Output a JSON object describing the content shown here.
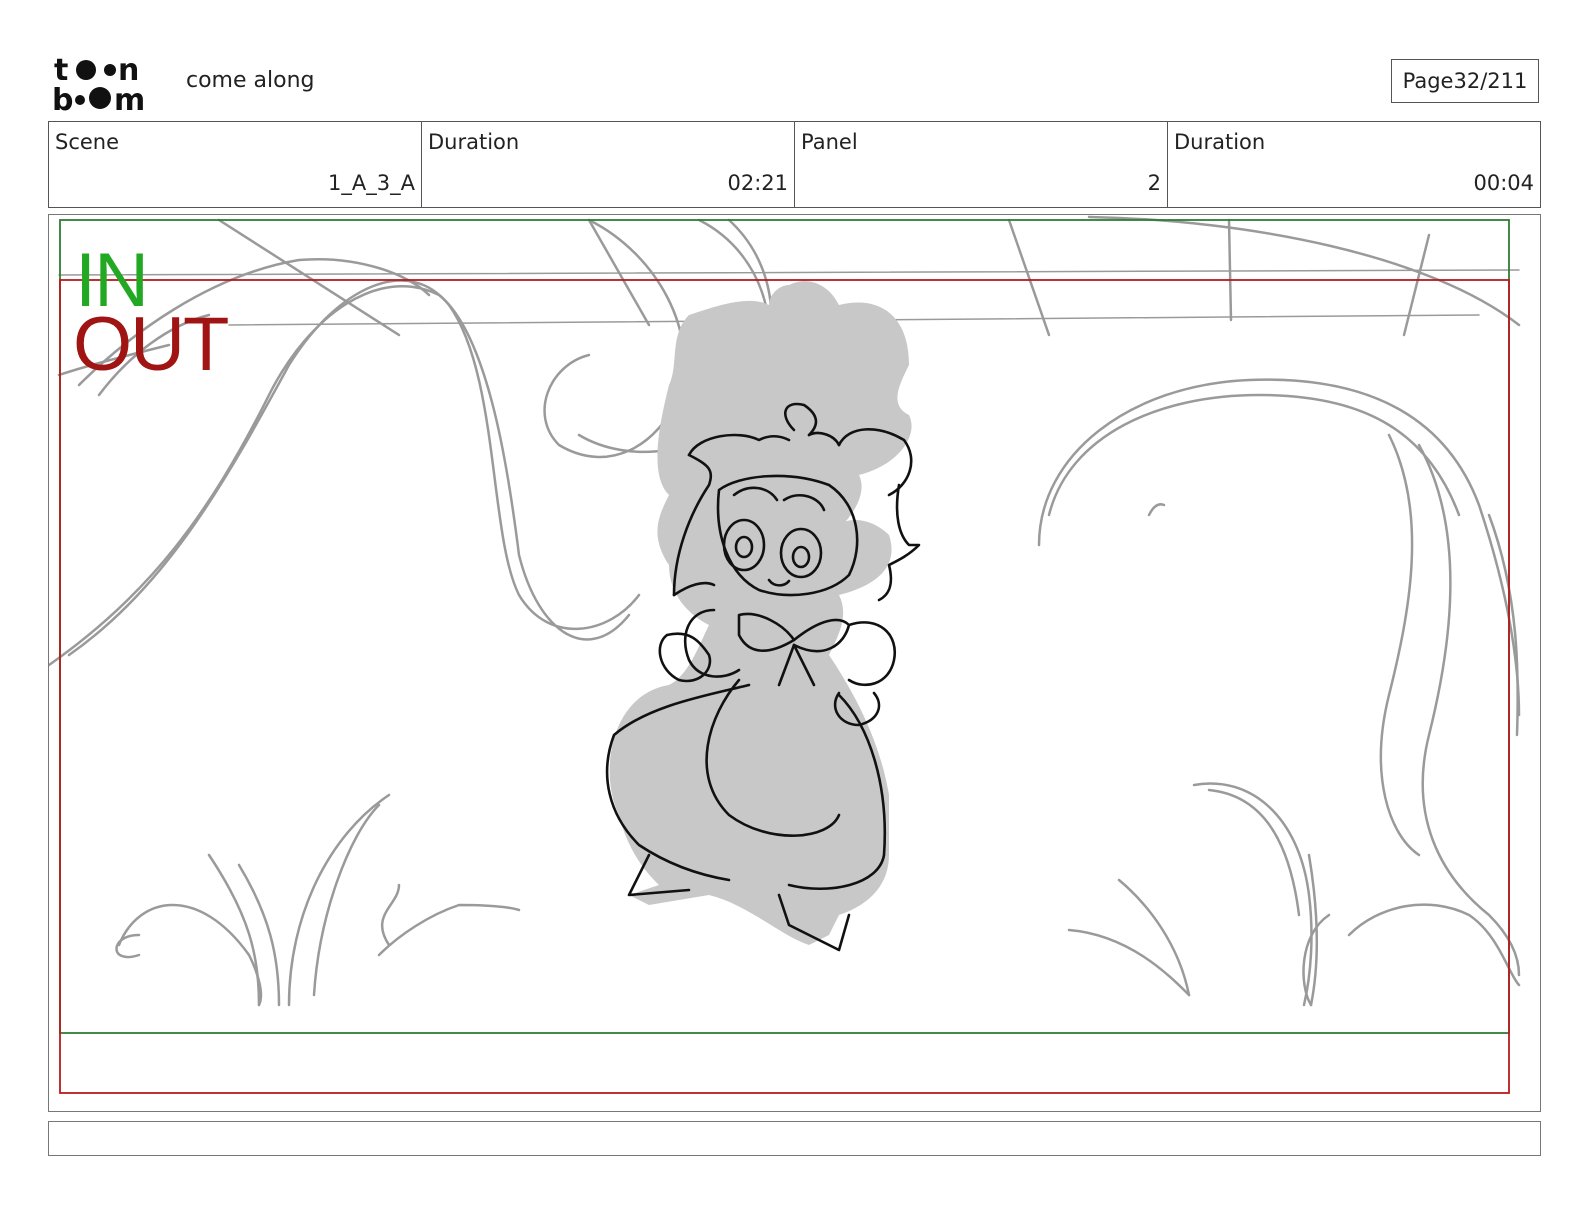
{
  "header": {
    "logo_name": "toon boom",
    "title": "come along",
    "page_label": "Page",
    "page_value": "32/211"
  },
  "info": [
    {
      "label": "Scene",
      "value": "1_A_3_A"
    },
    {
      "label": "Duration",
      "value": "02:21"
    },
    {
      "label": "Panel",
      "value": "2"
    },
    {
      "label": "Duration",
      "value": "00:04"
    }
  ],
  "panel": {
    "in_label": "IN",
    "out_label": "OUT",
    "in_frame_color": "#2e7d32",
    "out_frame_color": "#b71c1c",
    "sketch_color": "#9a9a9a",
    "character_fill": "#c8c8c8"
  },
  "notes": {
    "text": ""
  }
}
